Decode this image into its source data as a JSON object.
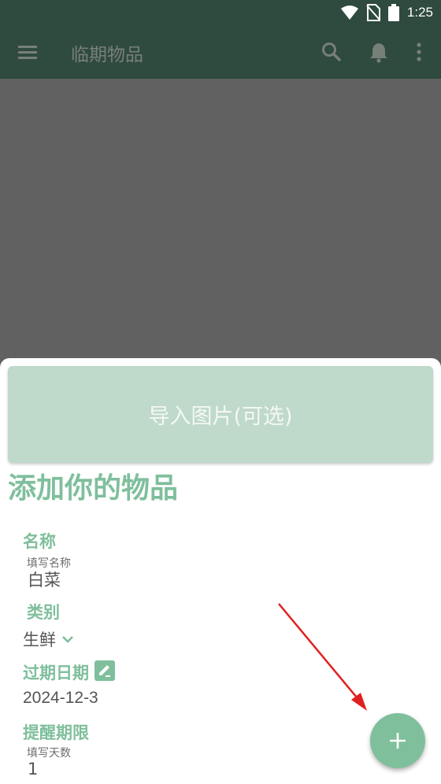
{
  "status_bar": {
    "time": "1:25",
    "icons": [
      "wifi-icon",
      "no-sim-icon",
      "battery-icon"
    ]
  },
  "app_bar": {
    "title": "临期物品",
    "icons": [
      "menu-icon",
      "search-icon",
      "bell-icon",
      "more-vert-icon"
    ]
  },
  "sheet": {
    "import_button_label": "导入图片(可选)",
    "title": "添加你的物品",
    "name": {
      "label": "名称",
      "hint": "填写名称",
      "value": "白菜"
    },
    "category": {
      "label": "类别",
      "value": "生鲜"
    },
    "expiry": {
      "label": "过期日期",
      "value": "2024-12-3"
    },
    "reminder": {
      "label": "提醒期限",
      "hint": "填写天数",
      "value": "1"
    }
  },
  "fab": {
    "icon": "plus-icon"
  },
  "colors": {
    "app_bar": "#2f4a3f",
    "accent": "#7fbf9c",
    "import_button": "#bfd9cb",
    "arrow": "#e02020"
  }
}
